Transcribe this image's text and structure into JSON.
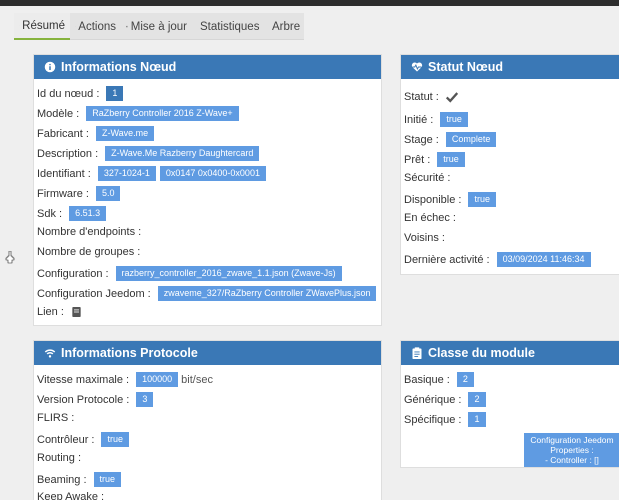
{
  "tabs": [
    {
      "label": "Résumé",
      "icon": "dashboard-icon"
    },
    {
      "label": "Actions",
      "icon": "list-icon"
    },
    {
      "label": "Mise à jour",
      "icon": "router-icon"
    },
    {
      "label": "Statistiques",
      "icon": "bar-chart-icon"
    },
    {
      "label": "Arbre",
      "icon": "tree-icon"
    }
  ],
  "node_info": {
    "title": "Informations Nœud",
    "id_label": "Id du nœud :",
    "id_value": "1",
    "model_label": "Modèle :",
    "model_value": "RaZberry Controller 2016 Z-Wave+",
    "manufacturer_label": "Fabricant :",
    "manufacturer_value": "Z-Wave.me",
    "description_label": "Description :",
    "description_value": "Z-Wave.Me Razberry Daughtercard",
    "identifier_label": "Identifiant :",
    "identifier_value1": "327-1024-1",
    "identifier_value2": "0x0147 0x0400-0x0001",
    "firmware_label": "Firmware :",
    "firmware_value": "5.0",
    "sdk_label": "Sdk :",
    "sdk_value": "6.51.3",
    "endpoints_label": "Nombre d'endpoints :",
    "groups_label": "Nombre de groupes :",
    "config_label": "Configuration :",
    "config_value": "razberry_controller_2016_zwave_1.1.json (Zwave-Js)",
    "jeedom_config_label": "Configuration Jeedom :",
    "jeedom_config_value": "zwaveme_327/RaZberry Controller ZWavePlus.json",
    "link_label": "Lien :"
  },
  "node_status": {
    "title": "Statut Nœud",
    "status_label": "Statut :",
    "initiated_label": "Initié :",
    "initiated_value": "true",
    "stage_label": "Stage :",
    "stage_value": "Complete",
    "ready_label": "Prêt :",
    "ready_value": "true",
    "security_label": "Sécurité :",
    "available_label": "Disponible :",
    "available_value": "true",
    "failed_label": "En échec :",
    "neighbors_label": "Voisins :",
    "last_activity_label": "Dernière activité :",
    "last_activity_value": "03/09/2024 11:46:34"
  },
  "protocol": {
    "title": "Informations Protocole",
    "speed_label": "Vitesse maximale :",
    "speed_value": "100000",
    "speed_unit": "bit/sec",
    "version_label": "Version Protocole :",
    "version_value": "3",
    "flirs_label": "FLIRS :",
    "controller_label": "Contrôleur :",
    "controller_value": "true",
    "routing_label": "Routing :",
    "beaming_label": "Beaming :",
    "beaming_value": "true",
    "keepawake_label": "Keep Awake :"
  },
  "module_class": {
    "title": "Classe du module",
    "basic_label": "Basique :",
    "basic_value": "2",
    "generic_label": "Générique :",
    "generic_value": "2",
    "specific_label": "Spécifique :",
    "specific_value": "1",
    "config_box_line1": "Configuration Jeedom",
    "config_box_line2": "Properties :",
    "config_box_line3": "- Controller : []"
  }
}
